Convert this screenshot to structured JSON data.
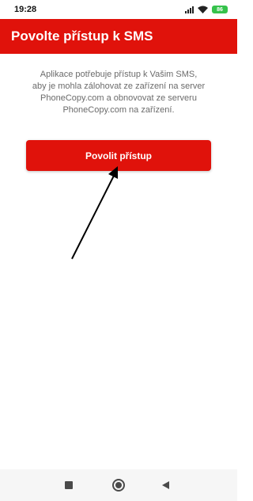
{
  "status_bar": {
    "time": "19:28",
    "icons": [
      "signal-icon",
      "wifi-icon",
      "battery-icon"
    ],
    "battery_text": "86"
  },
  "app_bar": {
    "title": "Povolte přístup k SMS",
    "color": "#e0120b"
  },
  "main": {
    "description_lines": [
      "Aplikace potřebuje přístup k Vašim SMS,",
      "aby je mohla zálohovat ze zařízení na server",
      "PhoneCopy.com a obnovovat ze serveru",
      "PhoneCopy.com na zařízení."
    ],
    "allow_button_label": "Povolit přístup",
    "button_color": "#e0120b"
  },
  "nav_bar": {
    "buttons": [
      "recent-apps-icon",
      "home-icon",
      "back-icon"
    ]
  }
}
